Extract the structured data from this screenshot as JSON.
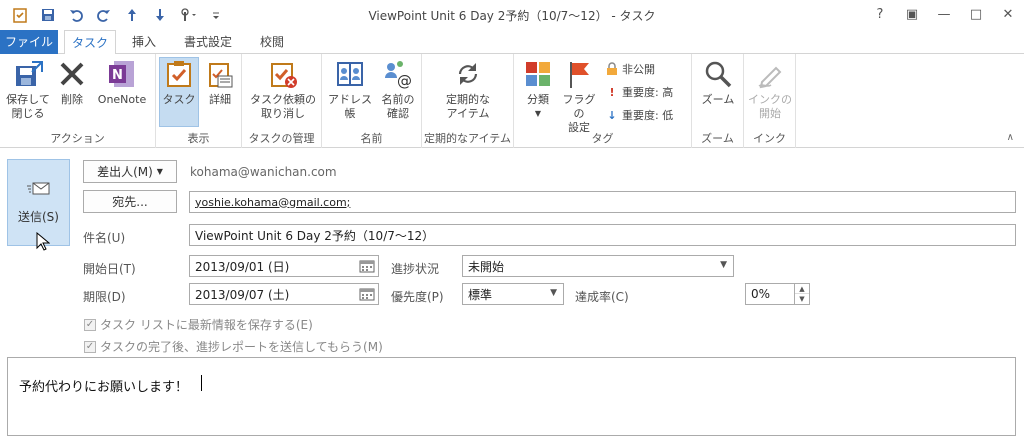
{
  "window": {
    "title": "ViewPoint Unit 6 Day 2予約（10/7～12） - タスク"
  },
  "window_controls": {
    "help": "?",
    "restore": "▣",
    "minimize": "—",
    "maximize": "□",
    "close": "✕"
  },
  "tabs": [
    {
      "label": "ファイル"
    },
    {
      "label": "タスク"
    },
    {
      "label": "挿入"
    },
    {
      "label": "書式設定"
    },
    {
      "label": "校閲"
    }
  ],
  "ribbon": {
    "action": {
      "label": "アクション",
      "save_close": [
        "保存して",
        "閉じる"
      ],
      "delete": "削除",
      "onenote": "OneNote"
    },
    "show": {
      "label": "表示",
      "task": "タスク",
      "details": "詳細"
    },
    "manage": {
      "label": "タスクの管理",
      "cancel_assign": [
        "タスク依頼の",
        "取り消し"
      ]
    },
    "names": {
      "label": "名前",
      "address_book": "アドレス帳",
      "check_names": [
        "名前の",
        "確認"
      ]
    },
    "recurrence": {
      "label": "定期的なアイテム",
      "recurrence": [
        "定期的な",
        "アイテム"
      ]
    },
    "tags": {
      "label": "タグ",
      "categorize": "分類",
      "follow_up": [
        "フラグの",
        "設定"
      ],
      "private": "非公開",
      "high": "重要度: 高",
      "low": "重要度: 低"
    },
    "zoom": {
      "label": "ズーム",
      "zoom": "ズーム"
    },
    "ink": {
      "label": "インク",
      "start_inking": [
        "インクの",
        "開始"
      ]
    }
  },
  "form": {
    "send": "送信(S)",
    "from_button": "差出人(M)",
    "from_value": "kohama@wanichan.com",
    "to_button": "宛先...",
    "to_value": "yoshie.kohama@gmail.com;",
    "subject_label": "件名(U)",
    "subject_value": "ViewPoint Unit 6 Day 2予約（10/7～12）",
    "start_label": "開始日(T)",
    "start_value": "2013/09/01 (日)",
    "due_label": "期限(D)",
    "due_value": "2013/09/07 (土)",
    "status_label": "進捗状況",
    "status_value": "未開始",
    "priority_label": "優先度(P)",
    "priority_value": "標準",
    "complete_label": "達成率(C)",
    "complete_value": "0%",
    "check1": "タスク リストに最新情報を保存する(E)",
    "check2": "タスクの完了後、進捗レポートを送信してもらう(M)"
  },
  "body": {
    "text": "予約代わりにお願いします！"
  }
}
